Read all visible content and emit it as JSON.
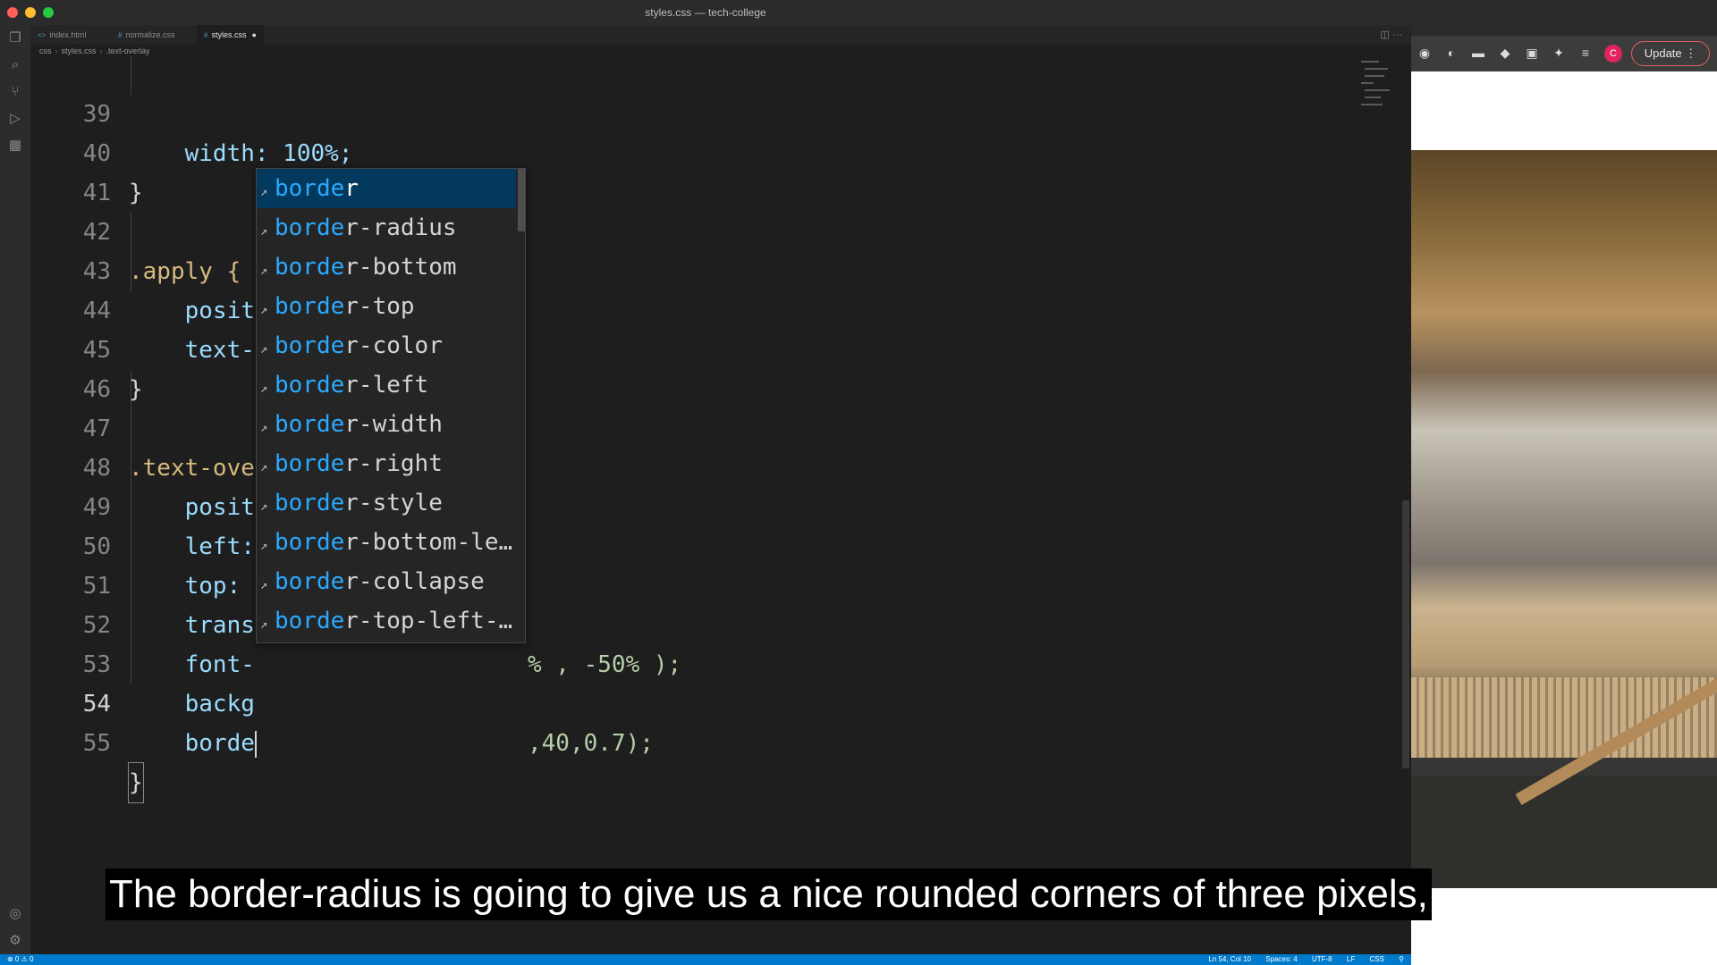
{
  "window": {
    "title": "styles.css — tech-college"
  },
  "tabs": [
    {
      "label": "index.html",
      "icon": "<>"
    },
    {
      "label": "normalize.css",
      "icon": "#"
    },
    {
      "label": "styles.css",
      "icon": "#",
      "dirty": "●"
    }
  ],
  "breadcrumb": {
    "part1": "css",
    "part2": "styles.css",
    "part3": ".text-overlay"
  },
  "code_lines": [
    {
      "num": "39",
      "text": "    width: 100%;"
    },
    {
      "num": "40",
      "text": "}"
    },
    {
      "num": "41",
      "text": ""
    },
    {
      "num": "42",
      "text": ".apply { "
    },
    {
      "num": "43",
      "text": "    posit"
    },
    {
      "num": "44",
      "text": "    text-"
    },
    {
      "num": "45",
      "text": "}"
    },
    {
      "num": "46",
      "text": ""
    },
    {
      "num": "47",
      "text": ".text-ove"
    },
    {
      "num": "48",
      "text": "    posit"
    },
    {
      "num": "49",
      "text": "    left:"
    },
    {
      "num": "50",
      "text": "    top: "
    },
    {
      "num": "51",
      "text": "    trans",
      "tail": "% , -50% );"
    },
    {
      "num": "52",
      "text": "    font-"
    },
    {
      "num": "53",
      "text": "    backg",
      "tail": ",40,0.7);"
    },
    {
      "num": "54",
      "text": "    borde"
    },
    {
      "num": "55",
      "text": "}"
    }
  ],
  "suggestions": {
    "match": "borde",
    "items": [
      "r",
      "r-radius",
      "r-bottom",
      "r-top",
      "r-color",
      "r-left",
      "r-width",
      "r-right",
      "r-style",
      "r-bottom-le…",
      "r-collapse",
      "r-top-left-…"
    ]
  },
  "statusbar": {
    "problems": "⊗ 0 ⚠ 0",
    "position": "Ln 54, Col 10",
    "spaces": "Spaces: 4",
    "encoding": "UTF-8",
    "eol": "LF",
    "language": "CSS"
  },
  "browser": {
    "update_label": "Update",
    "profile_initial": "C"
  },
  "caption": "The border-radius is going to give us a nice rounded corners of three pixels,"
}
